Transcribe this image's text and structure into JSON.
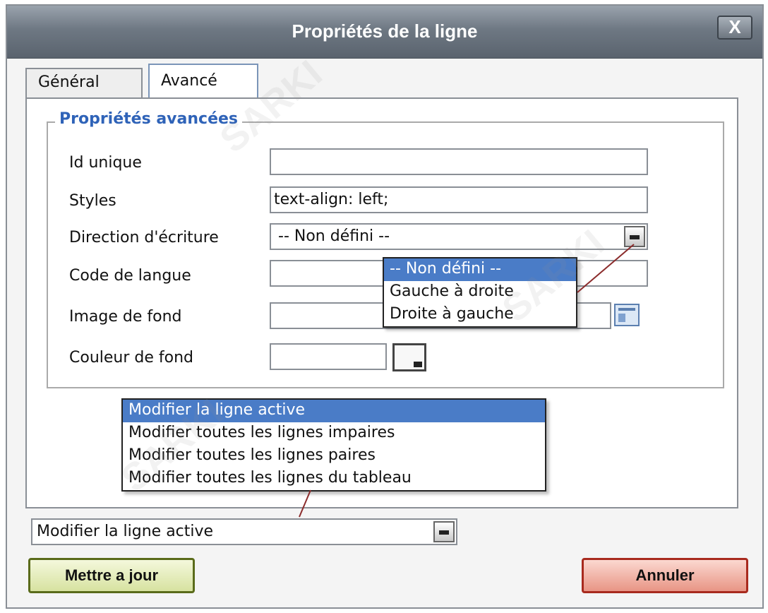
{
  "dialog": {
    "title": "Propriétés de la ligne",
    "close_label": "X"
  },
  "tabs": [
    {
      "label": "Général",
      "active": false
    },
    {
      "label": "Avancé",
      "active": true
    }
  ],
  "fieldset": {
    "legend": "Propriétés avancées",
    "fields": {
      "id": {
        "label": "Id unique",
        "value": ""
      },
      "styles": {
        "label": "Styles",
        "value": "text-align: left;"
      },
      "direction": {
        "label": "Direction d'écriture",
        "value": "-- Non défini --"
      },
      "lang": {
        "label": "Code de langue",
        "value": ""
      },
      "bgimage": {
        "label": "Image de fond",
        "value": ""
      },
      "bgcolor": {
        "label": "Couleur de fond",
        "value": ""
      }
    }
  },
  "direction_options": [
    "-- Non défini --",
    "Gauche à droite",
    "Droite à gauche"
  ],
  "scope": {
    "value": "Modifier la ligne active",
    "options": [
      "Modifier la ligne active",
      "Modifier toutes les lignes impaires",
      "Modifier toutes les lignes paires",
      "Modifier toutes les lignes du tableau"
    ]
  },
  "buttons": {
    "update": "Mettre a jour",
    "cancel": "Annuler"
  },
  "watermark": "SARKI",
  "colors": {
    "selection": "#4a7cc7",
    "legend": "#2f63b8",
    "update_border": "#5a6b1a",
    "cancel_border": "#a82a1e"
  }
}
